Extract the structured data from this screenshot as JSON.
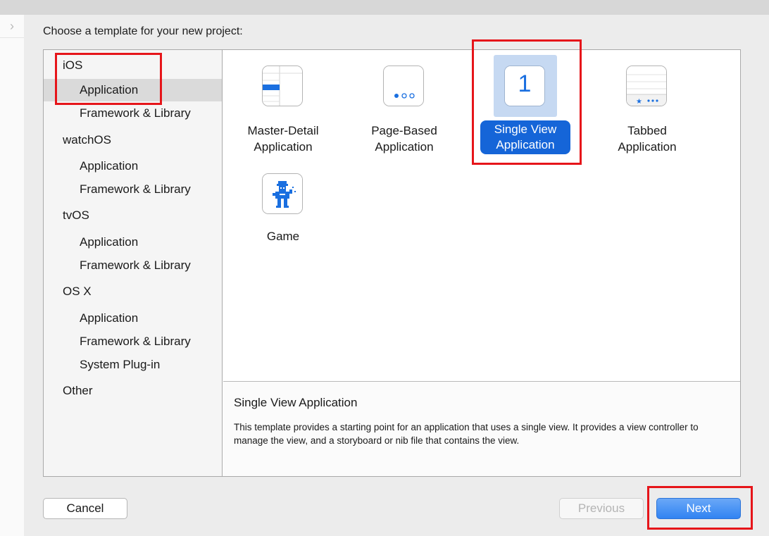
{
  "dialog": {
    "prompt": "Choose a template for your new project:"
  },
  "sidebar": {
    "items": [
      {
        "label": "iOS"
      },
      {
        "label": "Application"
      },
      {
        "label": "Framework & Library"
      },
      {
        "label": "watchOS"
      },
      {
        "label": "Application"
      },
      {
        "label": "Framework & Library"
      },
      {
        "label": "tvOS"
      },
      {
        "label": "Application"
      },
      {
        "label": "Framework & Library"
      },
      {
        "label": "OS X"
      },
      {
        "label": "Application"
      },
      {
        "label": "Framework & Library"
      },
      {
        "label": "System Plug-in"
      },
      {
        "label": "Other"
      }
    ],
    "selected_index": 1
  },
  "templates": [
    {
      "line1": "Master-Detail",
      "line2": "Application",
      "icon": "master-detail-icon"
    },
    {
      "line1": "Page-Based",
      "line2": "Application",
      "icon": "page-based-icon"
    },
    {
      "line1": "Single View",
      "line2": "Application",
      "icon": "single-view-icon",
      "glyph": "1",
      "selected": true
    },
    {
      "line1": "Tabbed",
      "line2": "Application",
      "icon": "tabbed-icon"
    },
    {
      "line1": "Game",
      "line2": "",
      "icon": "game-icon"
    }
  ],
  "description": {
    "title": "Single View Application",
    "text": "This template provides a starting point for an application that uses a single view. It provides a view controller to manage the view, and a storyboard or nib file that contains the view."
  },
  "buttons": {
    "cancel": "Cancel",
    "previous": "Previous",
    "next": "Next"
  },
  "colors": {
    "accent": "#1565d8",
    "highlight": "#e6151a",
    "selection_bg": "#c6d9f2"
  }
}
